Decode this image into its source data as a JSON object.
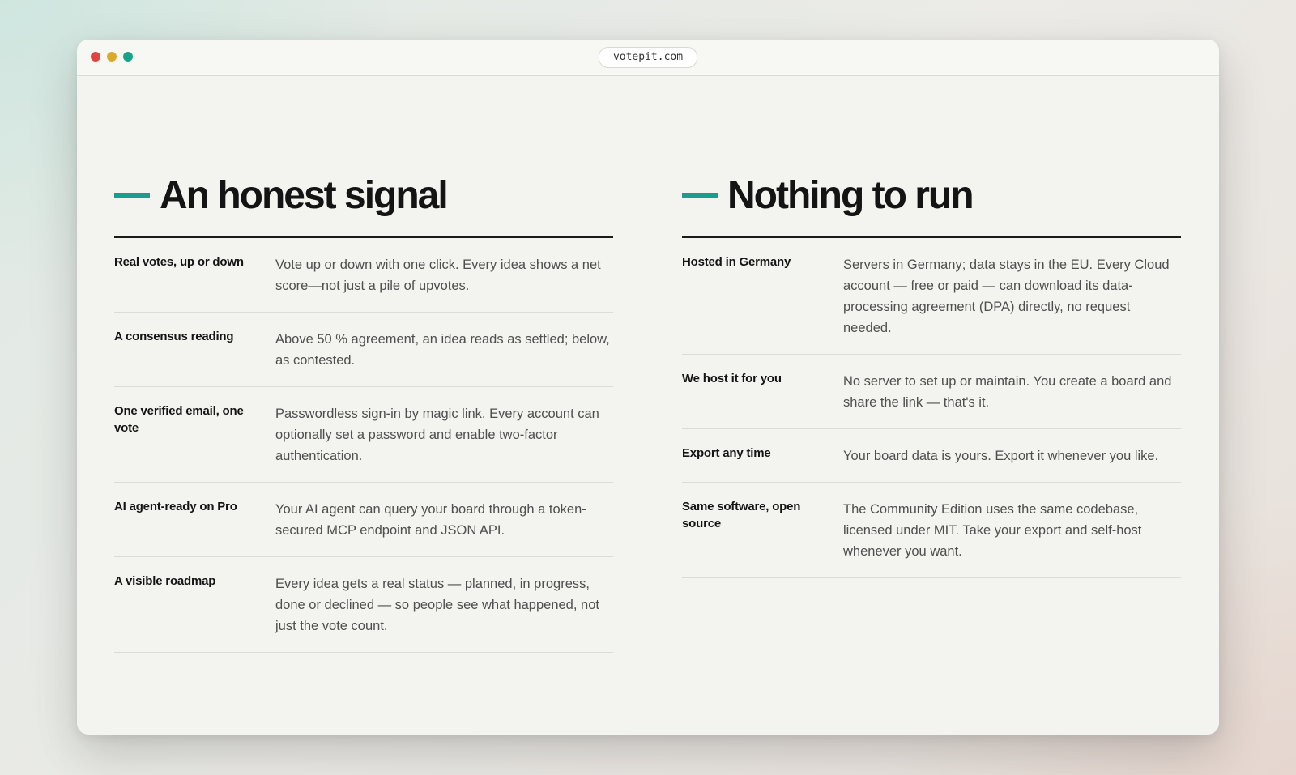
{
  "window": {
    "url": "votepit.com",
    "traffic_lights": {
      "close_color": "#e0443e",
      "minimize_color": "#dcaa2a",
      "zoom_color": "#19a28a"
    }
  },
  "accent_color": "#1a9e8a",
  "left_section": {
    "title": "An honest signal",
    "rows": [
      {
        "label": "Real votes, up or down",
        "description": "Vote up or down with one click. Every idea shows a net score—not just a pile of upvotes."
      },
      {
        "label": "A consensus reading",
        "description": "Above 50 % agreement, an idea reads as settled; below, as contested."
      },
      {
        "label": "One verified email, one vote",
        "description": "Passwordless sign-in by magic link. Every account can optionally set a password and enable two-factor authentication."
      },
      {
        "label": "AI agent-ready on Pro",
        "description": "Your AI agent can query your board through a token-secured MCP endpoint and JSON API."
      },
      {
        "label": "A visible roadmap",
        "description": "Every idea gets a real status — planned, in progress, done or declined — so people see what happened, not just the vote count."
      }
    ]
  },
  "right_section": {
    "title": "Nothing to run",
    "rows": [
      {
        "label": "Hosted in Germany",
        "description": "Servers in Germany; data stays in the EU. Every Cloud account — free or paid — can download its data-processing agreement (DPA) directly, no request needed."
      },
      {
        "label": "We host it for you",
        "description": "No server to set up or maintain. You create a board and share the link — that's it."
      },
      {
        "label": "Export any time",
        "description": "Your board data is yours. Export it whenever you like."
      },
      {
        "label": "Same software, open source",
        "description": "The Community Edition uses the same codebase, licensed under MIT. Take your export and self-host whenever you want."
      }
    ]
  }
}
